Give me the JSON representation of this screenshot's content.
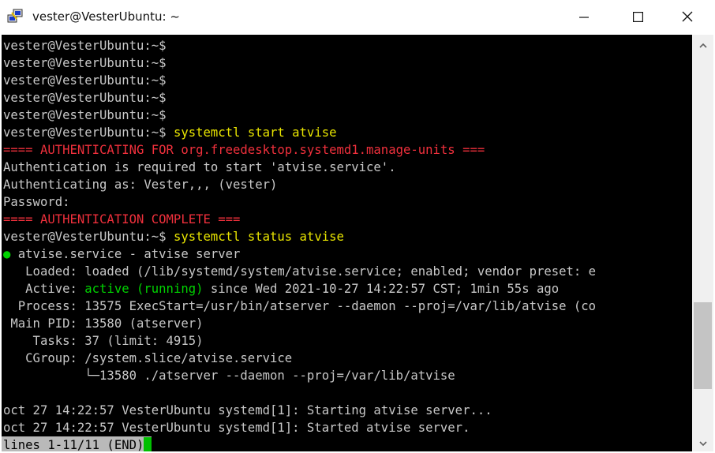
{
  "window": {
    "title": "vester@VesterUbuntu: ~",
    "minimize_label": "—",
    "maximize_label": "☐",
    "close_label": "✕"
  },
  "colors": {
    "default": "#c8c8c8",
    "command": "#e8e400",
    "auth": "#f0303c",
    "active": "#00d200",
    "dot": "#00d200"
  },
  "terminal": {
    "lines": [
      {
        "segs": [
          {
            "t": "vester@VesterUbuntu:~$",
            "c": "default"
          }
        ]
      },
      {
        "segs": [
          {
            "t": "vester@VesterUbuntu:~$",
            "c": "default"
          }
        ]
      },
      {
        "segs": [
          {
            "t": "vester@VesterUbuntu:~$",
            "c": "default"
          }
        ]
      },
      {
        "segs": [
          {
            "t": "vester@VesterUbuntu:~$",
            "c": "default"
          }
        ]
      },
      {
        "segs": [
          {
            "t": "vester@VesterUbuntu:~$",
            "c": "default"
          }
        ]
      },
      {
        "segs": [
          {
            "t": "vester@VesterUbuntu:~$ ",
            "c": "default"
          },
          {
            "t": "systemctl start atvise",
            "c": "command"
          }
        ]
      },
      {
        "segs": [
          {
            "t": "==== AUTHENTICATING FOR org.freedesktop.systemd1.manage-units ===",
            "c": "auth"
          }
        ]
      },
      {
        "segs": [
          {
            "t": "Authentication is required to start 'atvise.service'.",
            "c": "default"
          }
        ]
      },
      {
        "segs": [
          {
            "t": "Authenticating as: Vester,,, (vester)",
            "c": "default"
          }
        ]
      },
      {
        "segs": [
          {
            "t": "Password:",
            "c": "default"
          }
        ]
      },
      {
        "segs": [
          {
            "t": "==== AUTHENTICATION COMPLETE ===",
            "c": "auth"
          }
        ]
      },
      {
        "segs": [
          {
            "t": "vester@VesterUbuntu:~$ ",
            "c": "default"
          },
          {
            "t": "systemctl status atvise",
            "c": "command"
          }
        ]
      },
      {
        "segs": [
          {
            "t": "●",
            "c": "dot"
          },
          {
            "t": " atvise.service - atvise server",
            "c": "default"
          }
        ]
      },
      {
        "segs": [
          {
            "t": "   Loaded: loaded (/lib/systemd/system/atvise.service; enabled; vendor preset: e",
            "c": "default"
          }
        ]
      },
      {
        "segs": [
          {
            "t": "   Active: ",
            "c": "default"
          },
          {
            "t": "active (running)",
            "c": "active"
          },
          {
            "t": " since Wed 2021-10-27 14:22:57 CST; 1min 55s ago",
            "c": "default"
          }
        ]
      },
      {
        "segs": [
          {
            "t": "  Process: 13575 ExecStart=/usr/bin/atserver --daemon --proj=/var/lib/atvise (co",
            "c": "default"
          }
        ]
      },
      {
        "segs": [
          {
            "t": " Main PID: 13580 (atserver)",
            "c": "default"
          }
        ]
      },
      {
        "segs": [
          {
            "t": "    Tasks: 37 (limit: 4915)",
            "c": "default"
          }
        ]
      },
      {
        "segs": [
          {
            "t": "   CGroup: /system.slice/atvise.service",
            "c": "default"
          }
        ]
      },
      {
        "segs": [
          {
            "t": "           └─13580 ./atserver --daemon --proj=/var/lib/atvise",
            "c": "default"
          }
        ]
      },
      {
        "segs": [
          {
            "t": "",
            "c": "default"
          }
        ]
      },
      {
        "segs": [
          {
            "t": "oct 27 14:22:57 VesterUbuntu systemd[1]: Starting atvise server...",
            "c": "default"
          }
        ]
      },
      {
        "segs": [
          {
            "t": "oct 27 14:22:57 VesterUbuntu systemd[1]: Started atvise server.",
            "c": "default"
          }
        ]
      }
    ],
    "pager_status": "lines 1-11/11 (END)"
  },
  "scrollbar": {
    "up_icon": "chevron-up-icon",
    "down_icon": "chevron-down-icon",
    "position_fraction": 0.85
  }
}
